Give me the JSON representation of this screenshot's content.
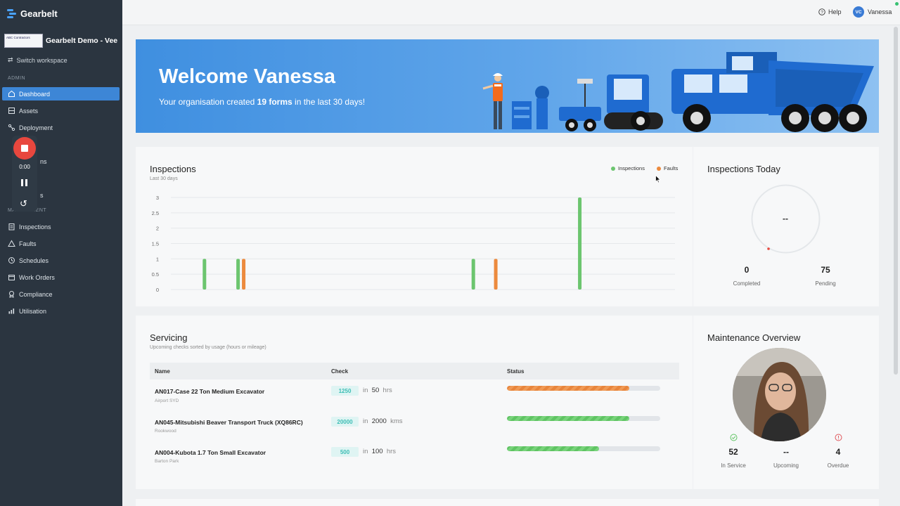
{
  "app": {
    "name": "Gearbelt"
  },
  "workspace": {
    "name": "Gearbelt Demo - Vee",
    "logo_text": "ABC Contractors",
    "switch_label": "Switch workspace"
  },
  "sidebar": {
    "admin_label": "ADMIN",
    "admin_items": [
      {
        "label": "Dashboard",
        "icon": "home-icon",
        "active": true
      },
      {
        "label": "Assets",
        "icon": "assets-icon"
      },
      {
        "label": "Deployment",
        "icon": "deployment-icon"
      },
      {
        "label": "",
        "icon": ""
      },
      {
        "label": "ns",
        "icon": ""
      },
      {
        "label": "s",
        "icon": ""
      }
    ],
    "management_label": "MANAGEMENT",
    "management_items": [
      {
        "label": "Inspections",
        "icon": "clipboard-icon"
      },
      {
        "label": "Faults",
        "icon": "warning-icon"
      },
      {
        "label": "Schedules",
        "icon": "clock-icon"
      },
      {
        "label": "Work Orders",
        "icon": "calendar-icon"
      },
      {
        "label": "Compliance",
        "icon": "badge-icon"
      },
      {
        "label": "Utilisation",
        "icon": "bar-chart-icon"
      }
    ]
  },
  "recorder": {
    "time": "0:00"
  },
  "topbar": {
    "help_label": "Help",
    "user_initials": "VC",
    "user_name": "Vanessa"
  },
  "banner": {
    "title": "Welcome Vanessa",
    "subtitle_prefix": "Your organisation created ",
    "subtitle_bold": "19 forms",
    "subtitle_suffix": " in the last 30 days!"
  },
  "inspections_card": {
    "title": "Inspections",
    "subtitle": "Last 30 days",
    "legend": [
      {
        "label": "Inspections",
        "color": "#6cc56f"
      },
      {
        "label": "Faults",
        "color": "#ec8a3e"
      }
    ]
  },
  "chart_data": {
    "type": "bar",
    "x": [
      3,
      6,
      6.5,
      27,
      29,
      36.5
    ],
    "ylim": [
      0,
      3
    ],
    "yticks": [
      "0",
      "0.5",
      "1",
      "1.5",
      "2",
      "2.5",
      "3"
    ],
    "grid": true,
    "legend_position": "top-right",
    "series": [
      {
        "name": "Inspections",
        "color": "#6cc56f",
        "values": [
          1,
          1,
          null,
          1,
          null,
          3
        ]
      },
      {
        "name": "Faults",
        "color": "#ec8a3e",
        "values": [
          null,
          null,
          1,
          null,
          1,
          null
        ]
      }
    ]
  },
  "inspections_today": {
    "title": "Inspections Today",
    "gauge_value": "--",
    "completed": {
      "value": "0",
      "label": "Completed"
    },
    "pending": {
      "value": "75",
      "label": "Pending"
    }
  },
  "servicing": {
    "title": "Servicing",
    "subtitle": "Upcoming checks sorted by usage (hours or mileage)",
    "columns": [
      "Name",
      "Check",
      "Status"
    ],
    "rows": [
      {
        "name": "AN017-Case 22 Ton Medium Excavator",
        "location": "Airport SYD",
        "check": "1250",
        "in_word": "in",
        "interval": "50",
        "unit": "hrs",
        "status_pct": 80,
        "status_color": "orange"
      },
      {
        "name": "AN045-Mitsubishi Beaver Transport Truck (XQ86RC)",
        "location": "Rookwood",
        "check": "20000",
        "in_word": "in",
        "interval": "2000",
        "unit": "kms",
        "status_pct": 80,
        "status_color": "green"
      },
      {
        "name": "AN004-Kubota 1.7 Ton Small Excavator",
        "location": "Barton Park",
        "check": "500",
        "in_word": "in",
        "interval": "100",
        "unit": "hrs",
        "status_pct": 60,
        "status_color": "green"
      }
    ]
  },
  "maintenance": {
    "title": "Maintenance Overview",
    "in_service": {
      "value": "52",
      "label": "In Service"
    },
    "upcoming": {
      "value": "--",
      "label": "Upcoming"
    },
    "overdue": {
      "value": "4",
      "label": "Overdue"
    }
  }
}
